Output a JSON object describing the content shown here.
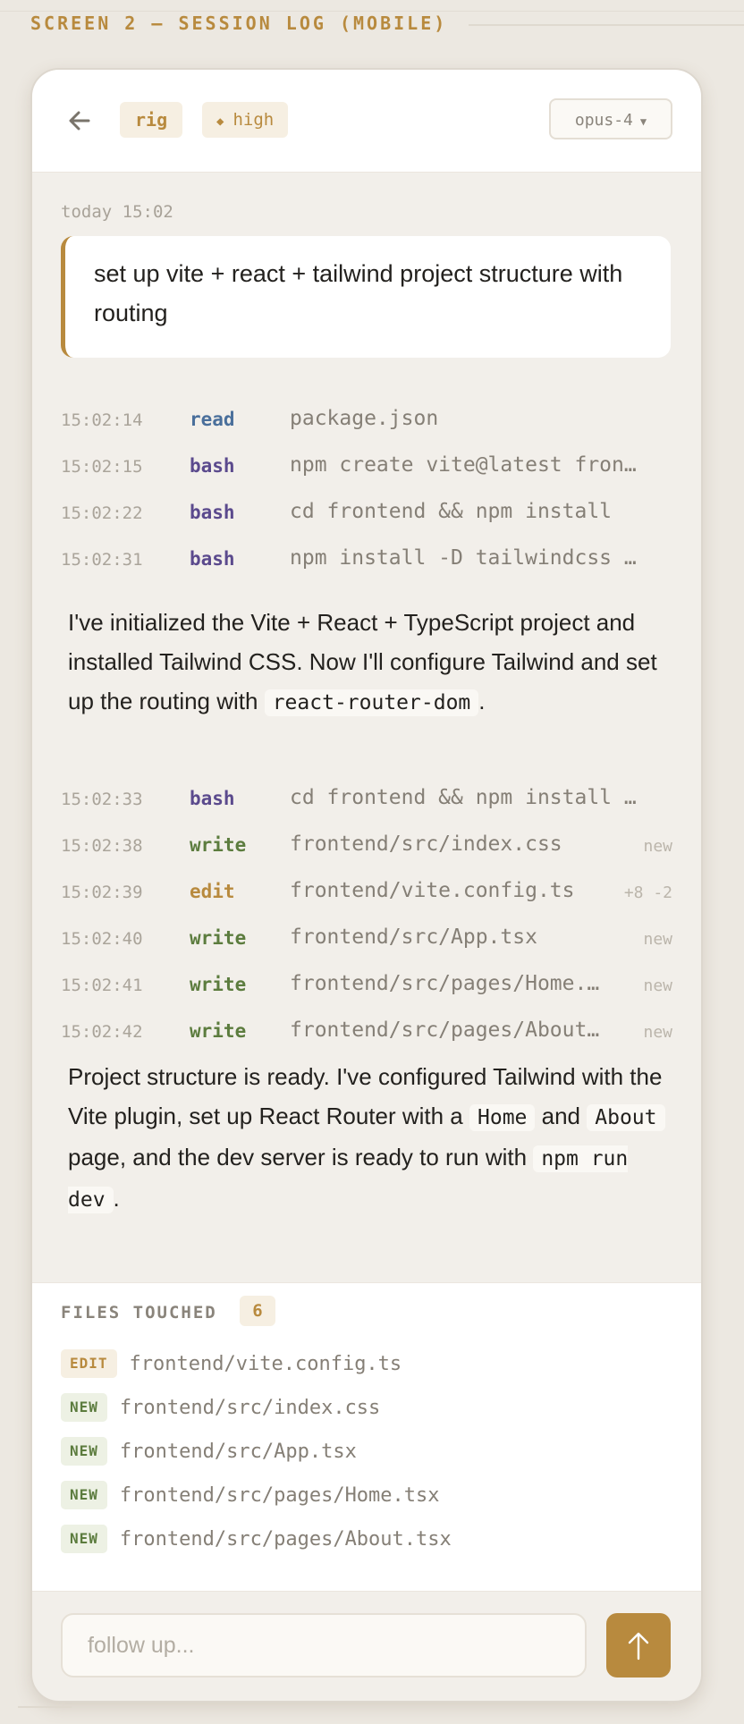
{
  "screen_label": "SCREEN 2 — SESSION LOG (MOBILE)",
  "header": {
    "back_icon": "arrow-left-icon",
    "tag_rig": "rig",
    "tag_priority": "high",
    "priority_icon": "diamond-icon",
    "model": "opus-4",
    "model_caret_icon": "caret-down-icon"
  },
  "session": {
    "timestamp": "today 15:02",
    "prompt": "set up vite + react + tailwind project structure with routing"
  },
  "log_groups": [
    [
      {
        "time": "15:02:14",
        "kind": "read",
        "arg": "package.json",
        "badge": ""
      },
      {
        "time": "15:02:15",
        "kind": "bash",
        "arg": "npm create vite@latest fron…",
        "badge": ""
      },
      {
        "time": "15:02:22",
        "kind": "bash",
        "arg": "cd frontend && npm install",
        "badge": ""
      },
      {
        "time": "15:02:31",
        "kind": "bash",
        "arg": "npm install -D tailwindcss …",
        "badge": ""
      }
    ],
    [
      {
        "time": "15:02:33",
        "kind": "bash",
        "arg": "cd frontend && npm install …",
        "badge": ""
      },
      {
        "time": "15:02:38",
        "kind": "write",
        "arg": "frontend/src/index.css",
        "badge": "new"
      },
      {
        "time": "15:02:39",
        "kind": "edit",
        "arg": "frontend/vite.config.ts",
        "badge": "+8 -2"
      },
      {
        "time": "15:02:40",
        "kind": "write",
        "arg": "frontend/src/App.tsx",
        "badge": "new"
      },
      {
        "time": "15:02:41",
        "kind": "write",
        "arg": "frontend/src/pages/Home.…",
        "badge": "new"
      },
      {
        "time": "15:02:42",
        "kind": "write",
        "arg": "frontend/src/pages/About…",
        "badge": "new"
      }
    ]
  ],
  "messages": {
    "m1_text_a": "I've initialized the Vite + React + TypeScript project and installed Tailwind CSS. Now I'll configure Tailwind and set up the routing with",
    "m1_code": "react-router-dom",
    "m1_text_b": ".",
    "m2_text_a": "Project structure is ready. I've configured Tailwind with the Vite plugin, set up React Router with a",
    "m2_code_1": "Home",
    "m2_text_b": "and",
    "m2_code_2": "About",
    "m2_text_c": "page, and the dev server is ready to run with",
    "m2_code_3": "npm run dev",
    "m2_text_d": "."
  },
  "files_touched": {
    "title": "FILES TOUCHED",
    "count": "6",
    "items": [
      {
        "badge": "EDIT",
        "path": "frontend/vite.config.ts"
      },
      {
        "badge": "NEW",
        "path": "frontend/src/index.css"
      },
      {
        "badge": "NEW",
        "path": "frontend/src/App.tsx"
      },
      {
        "badge": "NEW",
        "path": "frontend/src/pages/Home.tsx"
      },
      {
        "badge": "NEW",
        "path": "frontend/src/pages/About.tsx"
      }
    ]
  },
  "composer": {
    "placeholder": "follow up...",
    "send_icon": "arrow-up-icon"
  },
  "colors": {
    "accent": "#b88a3e",
    "read": "#4a6f9b",
    "bash": "#5b4a8d",
    "write": "#5c7c3e",
    "edit": "#b88a3e"
  }
}
